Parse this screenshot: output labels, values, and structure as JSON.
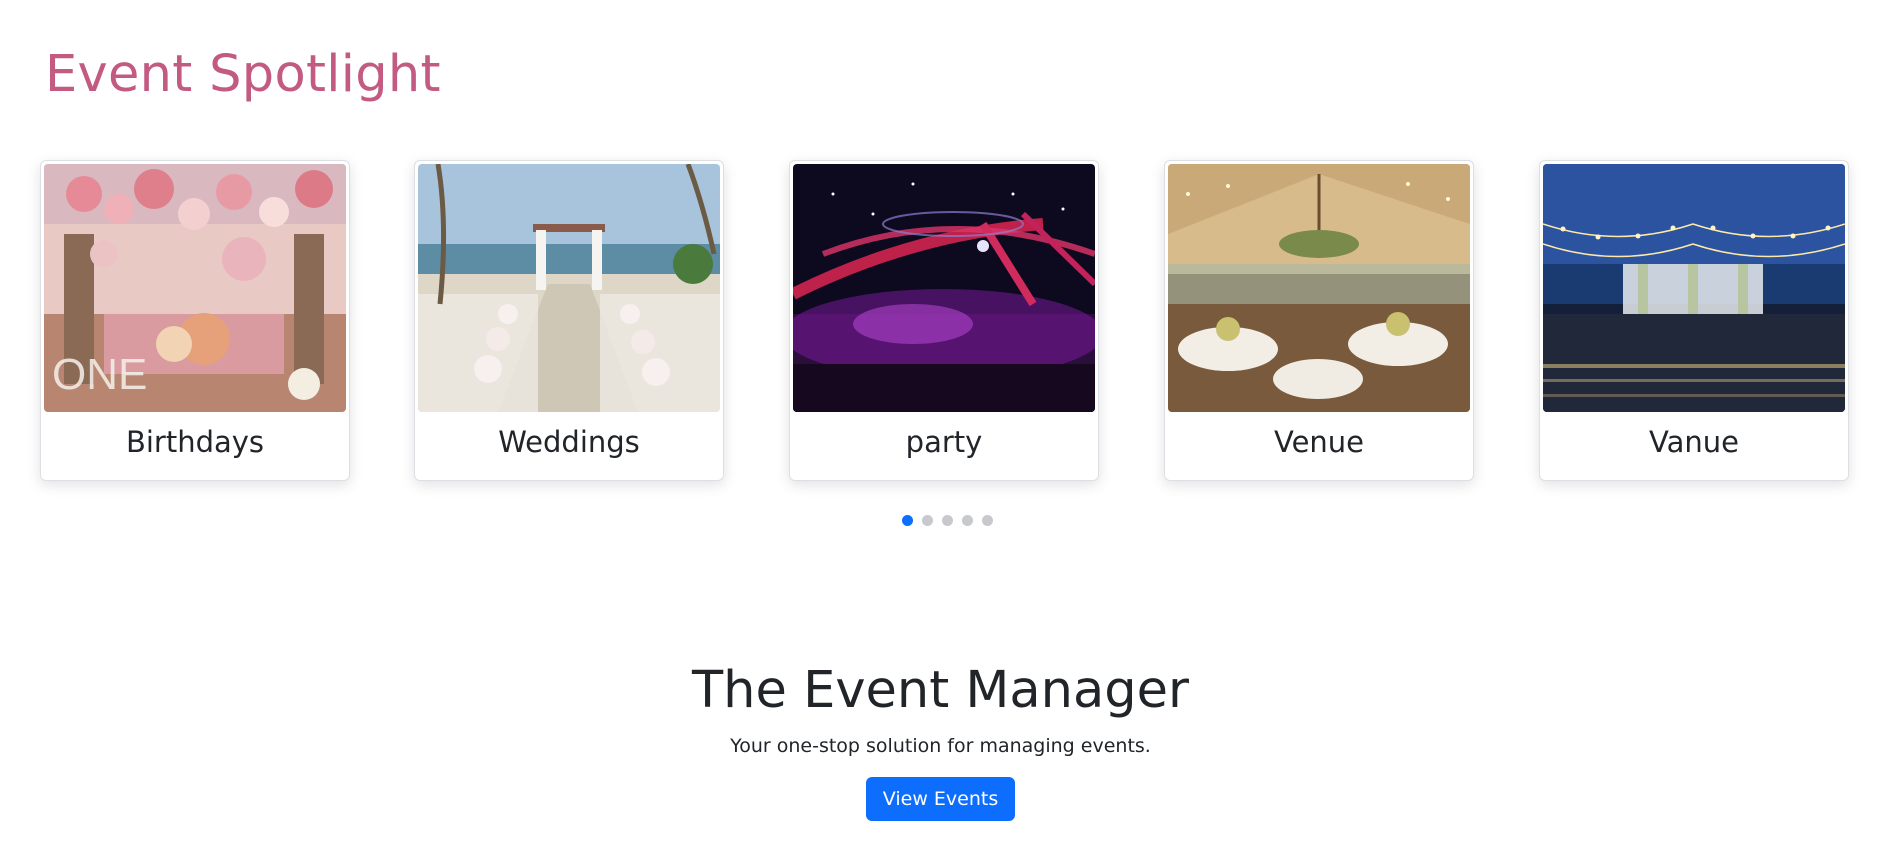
{
  "spotlight": {
    "title": "Event Spotlight",
    "cards": [
      {
        "label": "Birthdays",
        "image": "birthday-party-decor-image"
      },
      {
        "label": "Weddings",
        "image": "beach-wedding-aisle-image"
      },
      {
        "label": "party",
        "image": "concert-party-crowd-image"
      },
      {
        "label": "Venue",
        "image": "tent-banquet-venue-image"
      },
      {
        "label": "Vanue",
        "image": "outdoor-string-lights-venue-image"
      }
    ],
    "indicators": {
      "count": 5,
      "active_index": 0
    }
  },
  "hero": {
    "title": "The Event Manager",
    "subtitle": "Your one-stop solution for managing events.",
    "button_label": "View Events"
  },
  "colors": {
    "title_accent": "#c35a82",
    "primary": "#0d6efd",
    "indicator_inactive": "#c7c9cc"
  }
}
